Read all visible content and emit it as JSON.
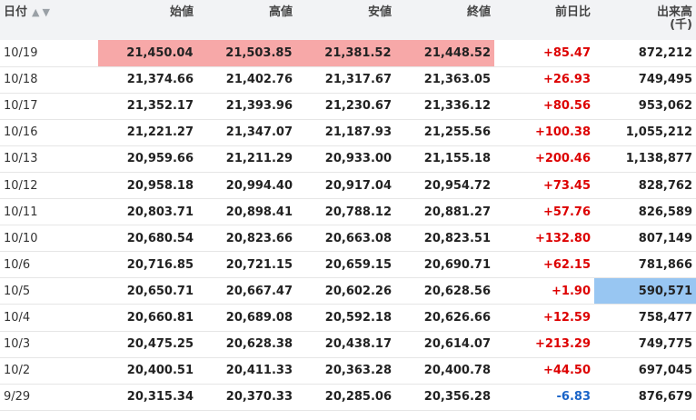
{
  "headers": {
    "date": "日付",
    "open": "始値",
    "high": "高値",
    "low": "安値",
    "close": "終値",
    "change": "前日比",
    "volume": "出来高",
    "volume_unit": "(千)"
  },
  "sort_icons": "▲▼",
  "colors": {
    "positive": "#dd0000",
    "negative": "#1a64c8",
    "highlight_red": "#f7a8a8",
    "highlight_blue": "#98c6f2"
  },
  "rows": [
    {
      "date": "10/19",
      "open": "21,450.04",
      "high": "21,503.85",
      "low": "21,381.52",
      "close": "21,448.52",
      "change": "+85.47",
      "volume": "872,212"
    },
    {
      "date": "10/18",
      "open": "21,374.66",
      "high": "21,402.76",
      "low": "21,317.67",
      "close": "21,363.05",
      "change": "+26.93",
      "volume": "749,495"
    },
    {
      "date": "10/17",
      "open": "21,352.17",
      "high": "21,393.96",
      "low": "21,230.67",
      "close": "21,336.12",
      "change": "+80.56",
      "volume": "953,062"
    },
    {
      "date": "10/16",
      "open": "21,221.27",
      "high": "21,347.07",
      "low": "21,187.93",
      "close": "21,255.56",
      "change": "+100.38",
      "volume": "1,055,212"
    },
    {
      "date": "10/13",
      "open": "20,959.66",
      "high": "21,211.29",
      "low": "20,933.00",
      "close": "21,155.18",
      "change": "+200.46",
      "volume": "1,138,877"
    },
    {
      "date": "10/12",
      "open": "20,958.18",
      "high": "20,994.40",
      "low": "20,917.04",
      "close": "20,954.72",
      "change": "+73.45",
      "volume": "828,762"
    },
    {
      "date": "10/11",
      "open": "20,803.71",
      "high": "20,898.41",
      "low": "20,788.12",
      "close": "20,881.27",
      "change": "+57.76",
      "volume": "826,589"
    },
    {
      "date": "10/10",
      "open": "20,680.54",
      "high": "20,823.66",
      "low": "20,663.08",
      "close": "20,823.51",
      "change": "+132.80",
      "volume": "807,149"
    },
    {
      "date": "10/6",
      "open": "20,716.85",
      "high": "20,721.15",
      "low": "20,659.15",
      "close": "20,690.71",
      "change": "+62.15",
      "volume": "781,866"
    },
    {
      "date": "10/5",
      "open": "20,650.71",
      "high": "20,667.47",
      "low": "20,602.26",
      "close": "20,628.56",
      "change": "+1.90",
      "volume": "590,571"
    },
    {
      "date": "10/4",
      "open": "20,660.81",
      "high": "20,689.08",
      "low": "20,592.18",
      "close": "20,626.66",
      "change": "+12.59",
      "volume": "758,477"
    },
    {
      "date": "10/3",
      "open": "20,475.25",
      "high": "20,628.38",
      "low": "20,438.17",
      "close": "20,614.07",
      "change": "+213.29",
      "volume": "749,775"
    },
    {
      "date": "10/2",
      "open": "20,400.51",
      "high": "20,411.33",
      "low": "20,363.28",
      "close": "20,400.78",
      "change": "+44.50",
      "volume": "697,045"
    },
    {
      "date": "9/29",
      "open": "20,315.34",
      "high": "20,370.33",
      "low": "20,285.06",
      "close": "20,356.28",
      "change": "-6.83",
      "volume": "876,679"
    }
  ]
}
